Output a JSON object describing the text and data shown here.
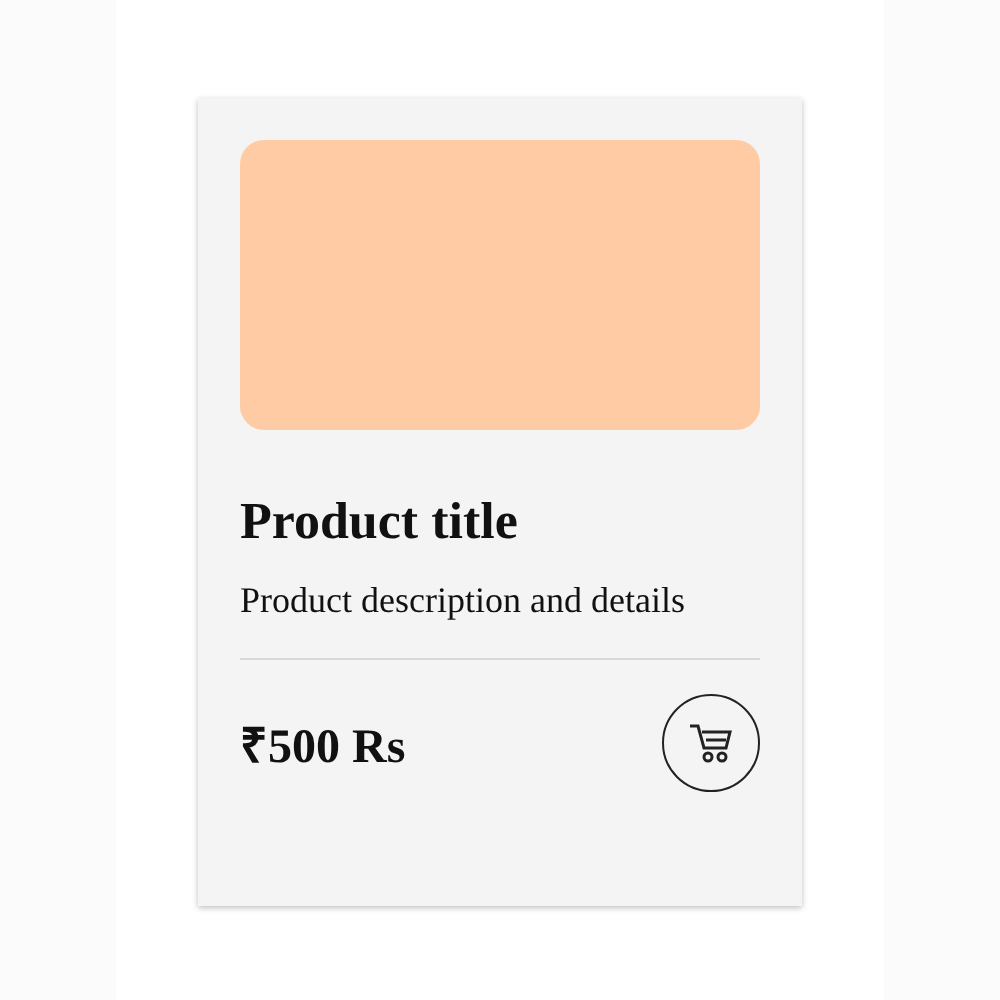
{
  "card": {
    "title": "Product title",
    "description": "Product description and details",
    "price": "₹500 Rs"
  }
}
